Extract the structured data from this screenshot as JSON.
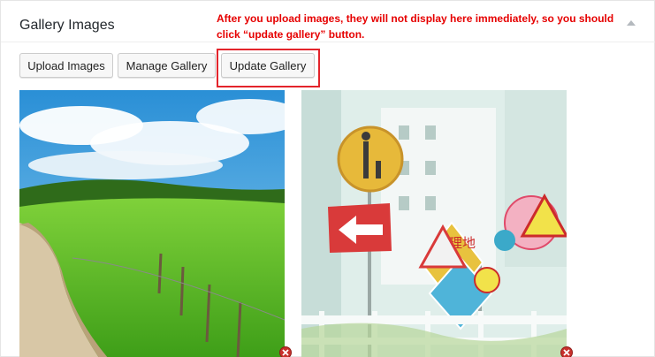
{
  "panel": {
    "title": "Gallery Images",
    "toggle_icon": "triangle-up-icon"
  },
  "annotation": {
    "text": "After you upload images, they will not display here immediately, so you should click “update gallery” button.",
    "color": "#e60000"
  },
  "toolbar": {
    "upload_label": "Upload Images",
    "manage_label": "Manage Gallery",
    "update_label": "Update Gallery"
  },
  "gallery": {
    "images": [
      {
        "description": "green countryside landscape with path",
        "remove_icon": "remove-x-icon"
      },
      {
        "description": "street signs in front of building",
        "remove_icon": "remove-x-icon"
      }
    ]
  },
  "colors": {
    "highlight": "#e3242b",
    "remove": "#c9302c"
  }
}
